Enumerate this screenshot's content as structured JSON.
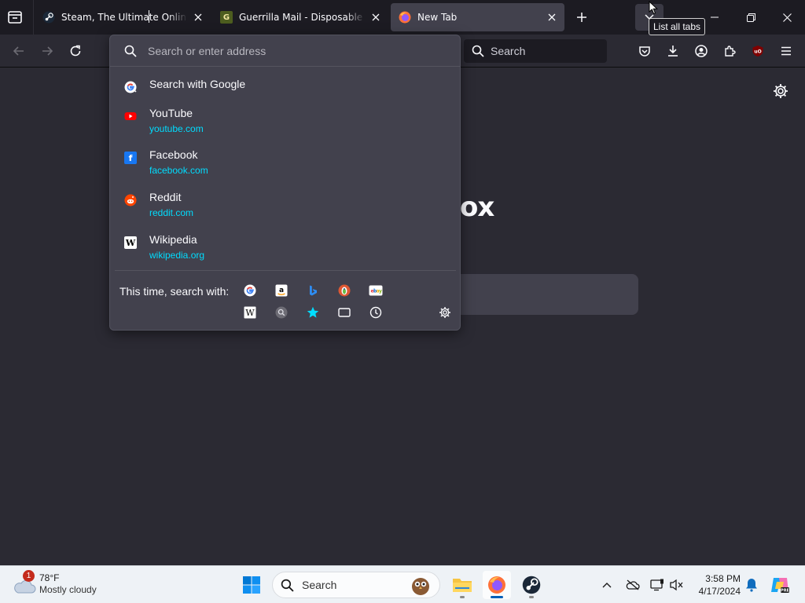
{
  "tabs": [
    {
      "title": "Steam, The Ultimate Online Game Platform",
      "active": false,
      "favicon": "steam-icon"
    },
    {
      "title": "Guerrilla Mail - Disposable Temporary E-Mail Address",
      "active": false,
      "favicon": "guerrilla-mail-icon"
    },
    {
      "title": "New Tab",
      "active": true,
      "favicon": "firefox-icon"
    }
  ],
  "tooltip": "List all tabs",
  "toolbar": {
    "search_placeholder": "Search"
  },
  "new_tab_page": {
    "brand_fragment": "ox"
  },
  "urlbar": {
    "placeholder": "Search or enter address",
    "value": "",
    "suggestions": [
      {
        "title": "Search with Google",
        "url": "",
        "icon": "google-icon"
      },
      {
        "title": "YouTube",
        "url": "youtube.com",
        "icon": "youtube-icon"
      },
      {
        "title": "Facebook",
        "url": "facebook.com",
        "icon": "facebook-icon"
      },
      {
        "title": "Reddit",
        "url": "reddit.com",
        "icon": "reddit-icon"
      },
      {
        "title": "Wikipedia",
        "url": "wikipedia.org",
        "icon": "wikipedia-icon"
      }
    ],
    "oneoff_label": "This time, search with:",
    "oneoff_engines": [
      "google-icon",
      "amazon-icon",
      "bing-icon",
      "duckduckgo-icon",
      "ebay-icon",
      "wikipedia-icon",
      "search-engine-icon",
      "bookmarks-star-icon",
      "tabs-icon",
      "history-icon"
    ]
  },
  "taskbar": {
    "weather_temp": "78°F",
    "weather_desc": "Mostly cloudy",
    "weather_badge": "1",
    "search_placeholder": "Search",
    "time": "3:58 PM",
    "date": "4/17/2024"
  },
  "colors": {
    "accent_link": "#00ddff",
    "popup_bg": "#42414d",
    "chrome_bg": "#1c1b22"
  }
}
